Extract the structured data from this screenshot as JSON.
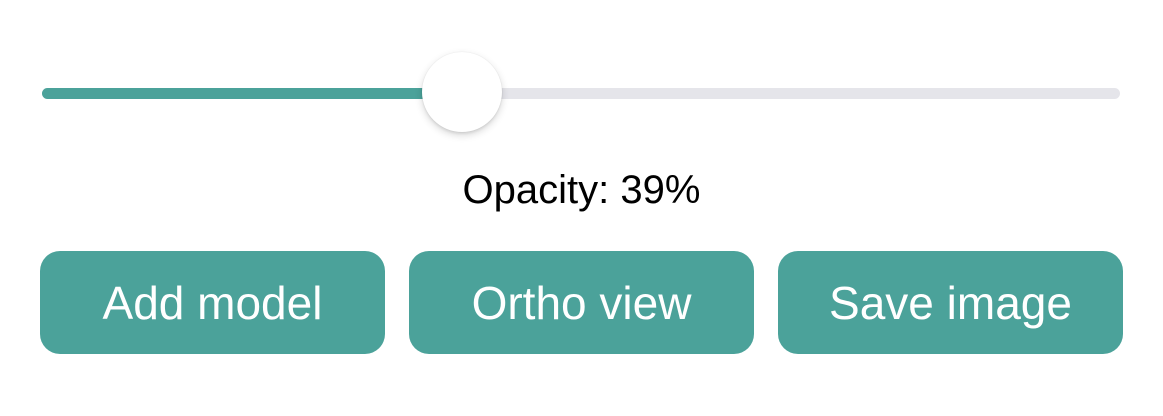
{
  "opacity": {
    "label": "Opacity: 39%",
    "value_percent": 39
  },
  "buttons": {
    "add_model": "Add model",
    "ortho_view": "Ortho view",
    "save_image": "Save image"
  },
  "colors": {
    "accent": "#4ba29a",
    "track": "#e5e5ea",
    "button_text": "#ffffff"
  }
}
